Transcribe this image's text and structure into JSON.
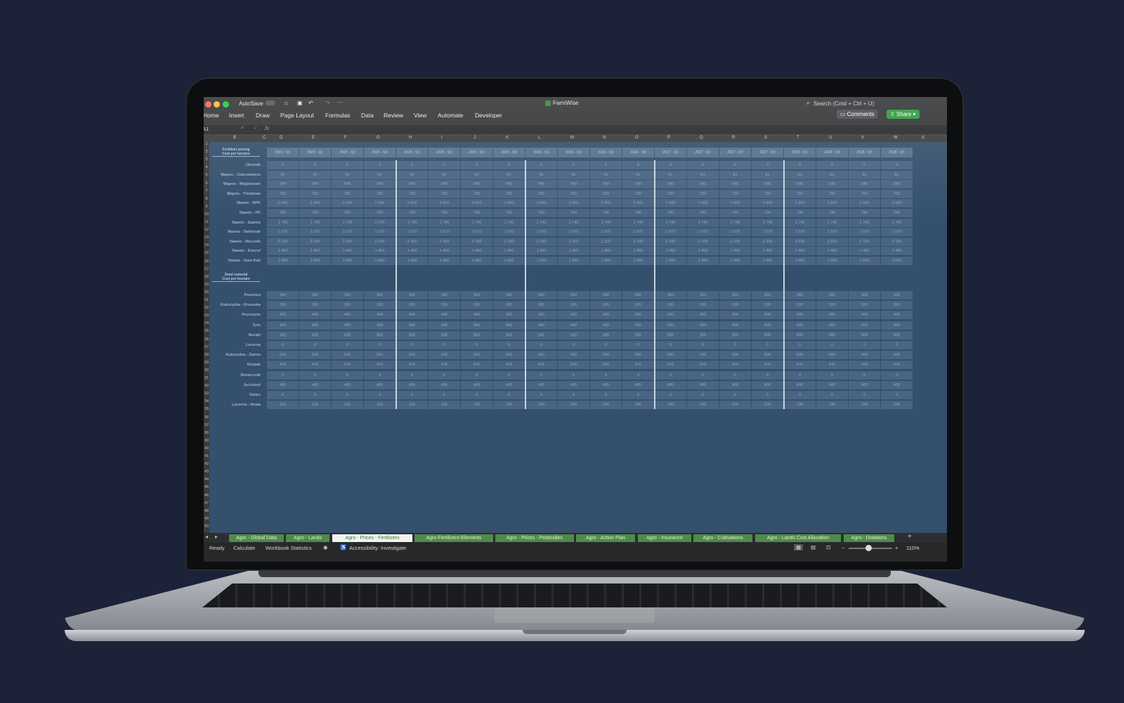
{
  "window": {
    "autosave_label": "AutoSave",
    "file_name": "FarmWise",
    "search_placeholder": "Search (Cmd + Ctrl + U)",
    "comments_label": "Comments",
    "share_label": "Share"
  },
  "ribbon": {
    "menu": [
      "Home",
      "Insert",
      "Draw",
      "Page Layout",
      "Formulas",
      "Data",
      "Review",
      "View",
      "Automate",
      "Developer"
    ]
  },
  "formula_bar": {
    "cell_ref": "A1",
    "fx_label": "fx"
  },
  "columns": [
    "B",
    "C",
    "D",
    "E",
    "F",
    "G",
    "H",
    "I",
    "J",
    "K",
    "L",
    "M",
    "N",
    "O",
    "P",
    "Q",
    "R",
    "S",
    "T",
    "U",
    "V",
    "W",
    "X"
  ],
  "quarters": [
    "2024 - Q1",
    "2024 - Q2",
    "2024 - Q3",
    "2024 - Q4",
    "2025 - Q1",
    "2025 - Q2",
    "2025 - Q3",
    "2025 - Q4",
    "2026 - Q1",
    "2026 - Q2",
    "2026 - Q3",
    "2026 - Q4",
    "2027 - Q1",
    "2027 - Q2",
    "2027 - Q3",
    "2027 - Q4",
    "2028 - Q1",
    "2028 - Q2",
    "2028 - Q3",
    "2028 - Q4"
  ],
  "fertilizer": {
    "title_line1": "Fertilizer pricing",
    "title_line2": "Cost per hectare",
    "rows": [
      {
        "label": "Obornik",
        "value": "0"
      },
      {
        "label": "Wapno - Cukrownicze",
        "value": "61"
      },
      {
        "label": "Wapno - Węglanowe",
        "value": "540"
      },
      {
        "label": "Wapno - Tlenkowe",
        "value": "750"
      },
      {
        "label": "Nawóz - NPK",
        "value": "2 500"
      },
      {
        "label": "Nawóz - PK",
        "value": "790"
      },
      {
        "label": "Nawóz - Saletra",
        "value": "1 740"
      },
      {
        "label": "Nawóz - Saletrzak",
        "value": "1 570"
      },
      {
        "label": "Nawóz - Mocznik",
        "value": "2 100"
      },
      {
        "label": "Nawóz - Kizeryt",
        "value": "1 460"
      },
      {
        "label": "Nawóz - Kam-Kali",
        "value": "1 660"
      }
    ]
  },
  "seed": {
    "title_line1": "Seed material",
    "title_line2": "Cost per hectare",
    "rows": [
      {
        "label": "Pszenica",
        "value": "360"
      },
      {
        "label": "Kukurydza - Kiszonka",
        "value": "320"
      },
      {
        "label": "Pszenżyto",
        "value": "400"
      },
      {
        "label": "Żyto",
        "value": "400"
      },
      {
        "label": "Buraki",
        "value": "905"
      },
      {
        "label": "Lucerna",
        "value": "0"
      },
      {
        "label": "Kukurydza - Ziarno",
        "value": "500"
      },
      {
        "label": "Rzepak",
        "value": "476"
      },
      {
        "label": "Słonecznik",
        "value": "0"
      },
      {
        "label": "Jęczmień",
        "value": "400"
      },
      {
        "label": "Owies",
        "value": "0"
      },
      {
        "label": "Lucerna - Nowa",
        "value": "100"
      }
    ]
  },
  "sheet_tabs": [
    "Agro - Global Data",
    "Agro - Lands",
    "Agro - Prices - Fertilizers",
    "Agro-Fertilizers-Elements",
    "Agro - Prices - Pesticidies",
    "Agro - Action Plan",
    "Agro - Insurance",
    "Agro - Cultivations",
    "Agro - Lands Cost Allocation",
    "Agro - Dotations"
  ],
  "active_tab": "Agro - Prices - Fertilizers",
  "status_bar": {
    "ready": "Ready",
    "calculate": "Calculate",
    "workbook_stats": "Workbook Statistics",
    "accessibility": "Accessibility: Investigate",
    "zoom": "110%"
  },
  "colors": {
    "background": "#1c2237",
    "sheet_bg": "#34506d",
    "tab_green": "#4f8a4c",
    "share_green": "#2e9a3d"
  }
}
